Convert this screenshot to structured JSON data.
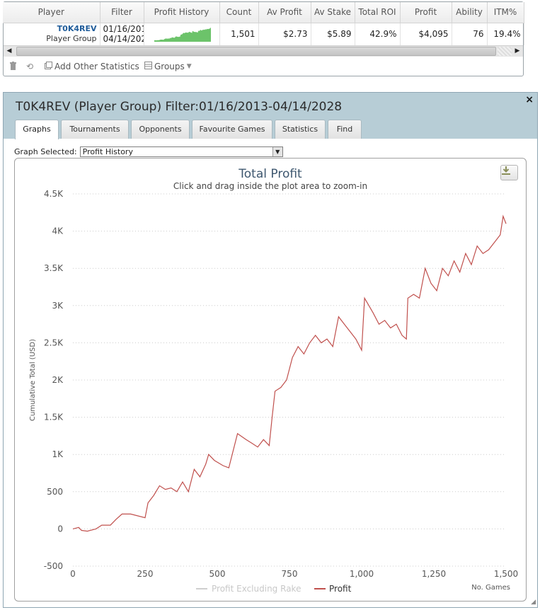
{
  "grid": {
    "headers": [
      "Player",
      "Filter",
      "Profit History",
      "Count",
      "Av Profit",
      "Av Stake",
      "Total ROI",
      "Profit",
      "Ability",
      "ITM%"
    ],
    "row": {
      "player_name": "T0K4REV",
      "player_type": "Player Group",
      "filter_start": "01/16/201",
      "filter_end": "04/14/202",
      "count": "1,501",
      "av_profit": "$2.73",
      "av_stake": "$5.89",
      "total_roi": "42.9%",
      "profit": "$4,095",
      "ability": "76",
      "itm": "19.4%"
    },
    "toolbar": {
      "delete_icon": "trash-icon",
      "refresh_icon": "refresh-icon",
      "add_stats_label": "Add Other Statistics",
      "groups_label": "Groups"
    }
  },
  "dialog": {
    "title": "T0K4REV (Player Group) Filter:01/16/2013-04/14/2028",
    "close_label": "×",
    "tabs": [
      {
        "label": "Graphs",
        "active": true
      },
      {
        "label": "Tournaments",
        "active": false
      },
      {
        "label": "Opponents",
        "active": false
      },
      {
        "label": "Favourite Games",
        "active": false
      },
      {
        "label": "Statistics",
        "active": false
      },
      {
        "label": "Find",
        "active": false
      }
    ],
    "graph_selected_label": "Graph Selected:",
    "graph_selected_value": "Profit History"
  },
  "colors": {
    "profit_line": "#c0504d",
    "excl_rake_line": "#cfcfcf",
    "spark_fill": "#6cc36a",
    "header_bg": "#b7cdd6"
  },
  "chart_data": {
    "type": "line",
    "title": "Total Profit",
    "subtitle": "Click and drag inside the plot area to zoom-in",
    "ylabel": "Cumulative Total (USD)",
    "xlabel": "No. Games",
    "xlim": [
      0,
      1500
    ],
    "ylim": [
      -500,
      4500
    ],
    "x_ticks": [
      0,
      250,
      500,
      750,
      1000,
      1250,
      1500
    ],
    "x_tick_labels": [
      "0",
      "250",
      "500",
      "750",
      "1,000",
      "1,250",
      "1,500"
    ],
    "y_ticks": [
      -500,
      0,
      500,
      1000,
      1500,
      2000,
      2500,
      3000,
      3500,
      4000,
      4500
    ],
    "y_tick_labels": [
      "-500",
      "0",
      "500",
      "1K",
      "1.5K",
      "2K",
      "2.5K",
      "3K",
      "3.5K",
      "4K",
      "4.5K"
    ],
    "grid": true,
    "legend_position": "bottom",
    "series": [
      {
        "name": "Profit Excluding Rake",
        "values": []
      },
      {
        "name": "Profit",
        "x": [
          0,
          20,
          30,
          50,
          80,
          100,
          130,
          150,
          170,
          200,
          250,
          260,
          280,
          300,
          320,
          340,
          360,
          380,
          400,
          420,
          440,
          460,
          470,
          490,
          520,
          540,
          570,
          600,
          620,
          640,
          660,
          680,
          690,
          700,
          720,
          740,
          760,
          780,
          800,
          820,
          840,
          860,
          880,
          900,
          920,
          940,
          960,
          980,
          1000,
          1010,
          1040,
          1060,
          1080,
          1100,
          1120,
          1140,
          1155,
          1160,
          1180,
          1200,
          1220,
          1240,
          1260,
          1280,
          1300,
          1320,
          1340,
          1360,
          1380,
          1400,
          1420,
          1440,
          1460,
          1480,
          1490,
          1500
        ],
        "values": [
          0,
          20,
          -20,
          -30,
          0,
          50,
          50,
          130,
          200,
          200,
          150,
          350,
          450,
          580,
          530,
          550,
          500,
          630,
          500,
          800,
          700,
          870,
          1000,
          920,
          850,
          820,
          1280,
          1200,
          1150,
          1100,
          1200,
          1120,
          1500,
          1850,
          1900,
          2000,
          2300,
          2450,
          2350,
          2500,
          2600,
          2500,
          2550,
          2450,
          2850,
          2750,
          2650,
          2550,
          2400,
          3100,
          2900,
          2750,
          2800,
          2700,
          2750,
          2600,
          2550,
          3100,
          3150,
          3100,
          3500,
          3300,
          3200,
          3500,
          3400,
          3600,
          3450,
          3700,
          3550,
          3800,
          3700,
          3750,
          3850,
          3950,
          4200,
          4100
        ]
      }
    ]
  }
}
